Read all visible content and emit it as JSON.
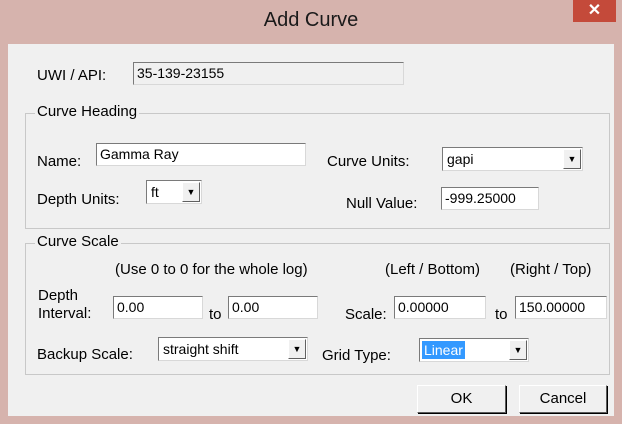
{
  "window": {
    "title": "Add Curve",
    "close_glyph": "✕"
  },
  "uwi": {
    "label": "UWI / API:",
    "value": "35-139-23155"
  },
  "curve_heading": {
    "title": "Curve Heading",
    "name_label": "Name:",
    "name_value": "Gamma Ray",
    "curve_units_label": "Curve Units:",
    "curve_units_value": "gapi",
    "depth_units_label": "Depth Units:",
    "depth_units_value": "ft",
    "null_value_label": "Null Value:",
    "null_value": "-999.25000"
  },
  "curve_scale": {
    "title": "Curve Scale",
    "depth_hint": "(Use 0 to 0 for the whole log)",
    "depth_label_1": "Depth",
    "depth_label_2": "Interval:",
    "depth_from": "0.00",
    "to_label_1": "to",
    "depth_to": "0.00",
    "left_bottom_label": "(Left / Bottom)",
    "right_top_label": "(Right / Top)",
    "scale_label": "Scale:",
    "scale_left": "0.00000",
    "to_label_2": "to",
    "scale_right": "150.00000",
    "backup_scale_label": "Backup Scale:",
    "backup_scale_value": "straight shift",
    "grid_type_label": "Grid Type:",
    "grid_type_value": "Linear"
  },
  "buttons": {
    "ok": "OK",
    "cancel": "Cancel"
  },
  "colors": {
    "titlebar": "#d6b3ad",
    "close": "#c44a3a",
    "selection": "#3399ff",
    "dialog": "#f0f0f0"
  },
  "icons": {
    "dropdown": "triangle-down-icon",
    "close": "close-icon"
  }
}
